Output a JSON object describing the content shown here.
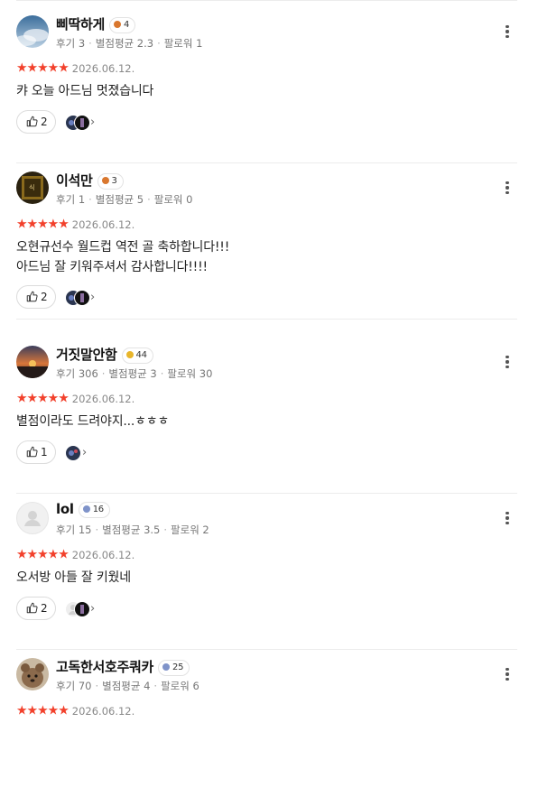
{
  "reviews": [
    {
      "username": "삐딱하게",
      "level": "4",
      "badge_color": "#d9772e",
      "meta": {
        "reviews": "후기 3",
        "avg": "별점평균 2.3",
        "followers": "팔로워 1"
      },
      "stars": "★★★★★",
      "date": "2026.06.12.",
      "text": "캬 오늘 아드님 멋졌습니다",
      "likes": "2"
    },
    {
      "username": "이석만",
      "level": "3",
      "badge_color": "#d9772e",
      "meta": {
        "reviews": "후기 1",
        "avg": "별점평균 5",
        "followers": "팔로워 0"
      },
      "stars": "★★★★★",
      "date": "2026.06.12.",
      "text": "오현규선수 월드컵 역전 골 축하합니다!!!\n아드님 잘 키워주셔서 감사합니다!!!!",
      "likes": "2"
    },
    {
      "username": "거짓말안함",
      "level": "44",
      "badge_color": "#e8b52a",
      "meta": {
        "reviews": "후기 306",
        "avg": "별점평균 3",
        "followers": "팔로워 30"
      },
      "stars": "★★★★★",
      "date": "2026.06.12.",
      "text": "별점이라도 드려야지...ㅎㅎㅎ",
      "likes": "1"
    },
    {
      "username": "lol",
      "level": "16",
      "badge_color": "#7f93c9",
      "meta": {
        "reviews": "후기 15",
        "avg": "별점평균 3.5",
        "followers": "팔로워 2"
      },
      "stars": "★★★★★",
      "date": "2026.06.12.",
      "text": "오서방 아들 잘 키웠네",
      "likes": "2"
    },
    {
      "username": "고독한서호주쿼카",
      "level": "25",
      "badge_color": "#7f93c9",
      "meta": {
        "reviews": "후기 70",
        "avg": "별점평균 4",
        "followers": "팔로워 6"
      },
      "stars": "★★★★★",
      "date": "2026.06.12."
    }
  ],
  "icons": {
    "like": "thumbs-up-icon",
    "more": "more-vertical-icon",
    "chevron": "chevron-right-icon"
  },
  "colors": {
    "star": "#f2402b",
    "divider": "#ececec"
  }
}
